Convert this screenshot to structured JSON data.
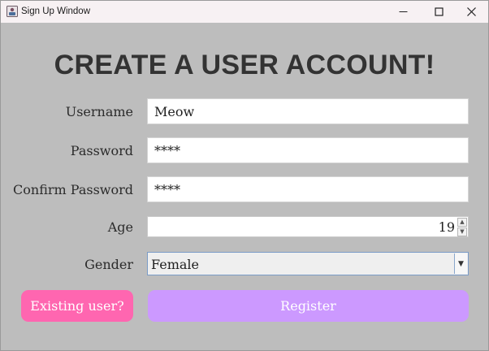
{
  "window": {
    "title": "Sign Up Window"
  },
  "controls": {
    "minimize": "—",
    "maximize": "☐",
    "close": "✕"
  },
  "heading": "CREATE A USER ACCOUNT!",
  "form": {
    "username_label": "Username",
    "username_value": "Meow",
    "password_label": "Password",
    "password_value": "****",
    "confirm_label": "Confirm Password",
    "confirm_value": "****",
    "age_label": "Age",
    "age_value": "19",
    "gender_label": "Gender",
    "gender_value": "Female"
  },
  "buttons": {
    "existing_user": "Existing user?",
    "register": "Register"
  },
  "colors": {
    "existing_button": "#ff66b0",
    "register_button": "#cc99ff",
    "background": "#bdbdbd"
  }
}
